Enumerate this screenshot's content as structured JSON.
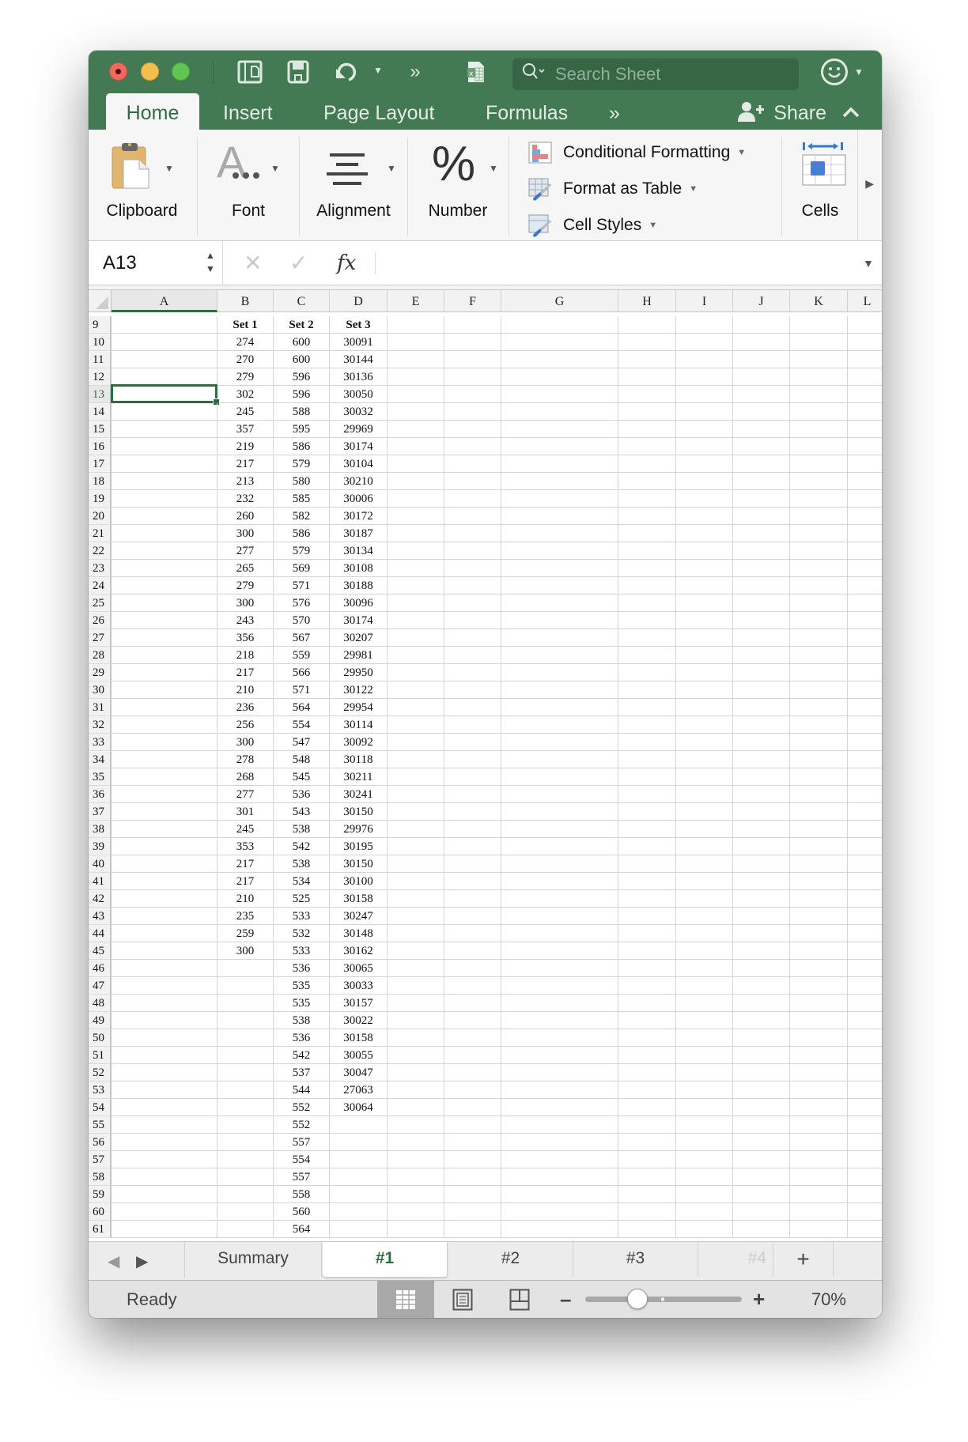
{
  "window": {
    "toolbar": {
      "search_placeholder": "Search Sheet",
      "icons": [
        "sidebar-icon",
        "save-icon",
        "undo-icon",
        "more-icon",
        "excel-doc-icon",
        "smiley-feedback-icon"
      ]
    },
    "ribbon_tabs": [
      {
        "label": "Home",
        "active": true
      },
      {
        "label": "Insert",
        "active": false
      },
      {
        "label": "Page Layout",
        "active": false
      },
      {
        "label": "Formulas",
        "active": false
      }
    ],
    "more_tabs_label": "»",
    "share_label": "Share",
    "ribbon_groups": {
      "clipboard": "Clipboard",
      "font": "Font",
      "alignment": "Alignment",
      "number": "Number",
      "number_glyph": "%",
      "font_glyph": "A",
      "cells": "Cells",
      "styles": [
        {
          "label": "Conditional Formatting"
        },
        {
          "label": "Format as Table"
        },
        {
          "label": "Cell Styles"
        }
      ]
    }
  },
  "formula_bar": {
    "name_box": "A13",
    "cancel_glyph": "✕",
    "enter_glyph": "✓",
    "fx_label": "fx",
    "formula_value": ""
  },
  "grid": {
    "columns": [
      "A",
      "B",
      "C",
      "D",
      "E",
      "F",
      "G",
      "H",
      "I",
      "J",
      "K",
      "L"
    ],
    "selected_column": "A",
    "selected_row": 13,
    "rows": [
      {
        "n": 9,
        "B": "Set 1",
        "C": "Set 2",
        "D": "Set 3",
        "header": true
      },
      {
        "n": 10,
        "B": "274",
        "C": "600",
        "D": "30091"
      },
      {
        "n": 11,
        "B": "270",
        "C": "600",
        "D": "30144"
      },
      {
        "n": 12,
        "B": "279",
        "C": "596",
        "D": "30136"
      },
      {
        "n": 13,
        "B": "302",
        "C": "596",
        "D": "30050"
      },
      {
        "n": 14,
        "B": "245",
        "C": "588",
        "D": "30032"
      },
      {
        "n": 15,
        "B": "357",
        "C": "595",
        "D": "29969"
      },
      {
        "n": 16,
        "B": "219",
        "C": "586",
        "D": "30174"
      },
      {
        "n": 17,
        "B": "217",
        "C": "579",
        "D": "30104"
      },
      {
        "n": 18,
        "B": "213",
        "C": "580",
        "D": "30210"
      },
      {
        "n": 19,
        "B": "232",
        "C": "585",
        "D": "30006"
      },
      {
        "n": 20,
        "B": "260",
        "C": "582",
        "D": "30172"
      },
      {
        "n": 21,
        "B": "300",
        "C": "586",
        "D": "30187"
      },
      {
        "n": 22,
        "B": "277",
        "C": "579",
        "D": "30134"
      },
      {
        "n": 23,
        "B": "265",
        "C": "569",
        "D": "30108"
      },
      {
        "n": 24,
        "B": "279",
        "C": "571",
        "D": "30188"
      },
      {
        "n": 25,
        "B": "300",
        "C": "576",
        "D": "30096"
      },
      {
        "n": 26,
        "B": "243",
        "C": "570",
        "D": "30174"
      },
      {
        "n": 27,
        "B": "356",
        "C": "567",
        "D": "30207"
      },
      {
        "n": 28,
        "B": "218",
        "C": "559",
        "D": "29981"
      },
      {
        "n": 29,
        "B": "217",
        "C": "566",
        "D": "29950"
      },
      {
        "n": 30,
        "B": "210",
        "C": "571",
        "D": "30122"
      },
      {
        "n": 31,
        "B": "236",
        "C": "564",
        "D": "29954"
      },
      {
        "n": 32,
        "B": "256",
        "C": "554",
        "D": "30114"
      },
      {
        "n": 33,
        "B": "300",
        "C": "547",
        "D": "30092"
      },
      {
        "n": 34,
        "B": "278",
        "C": "548",
        "D": "30118"
      },
      {
        "n": 35,
        "B": "268",
        "C": "545",
        "D": "30211"
      },
      {
        "n": 36,
        "B": "277",
        "C": "536",
        "D": "30241"
      },
      {
        "n": 37,
        "B": "301",
        "C": "543",
        "D": "30150"
      },
      {
        "n": 38,
        "B": "245",
        "C": "538",
        "D": "29976"
      },
      {
        "n": 39,
        "B": "353",
        "C": "542",
        "D": "30195"
      },
      {
        "n": 40,
        "B": "217",
        "C": "538",
        "D": "30150"
      },
      {
        "n": 41,
        "B": "217",
        "C": "534",
        "D": "30100"
      },
      {
        "n": 42,
        "B": "210",
        "C": "525",
        "D": "30158"
      },
      {
        "n": 43,
        "B": "235",
        "C": "533",
        "D": "30247"
      },
      {
        "n": 44,
        "B": "259",
        "C": "532",
        "D": "30148"
      },
      {
        "n": 45,
        "B": "300",
        "C": "533",
        "D": "30162"
      },
      {
        "n": 46,
        "B": "",
        "C": "536",
        "D": "30065"
      },
      {
        "n": 47,
        "B": "",
        "C": "535",
        "D": "30033"
      },
      {
        "n": 48,
        "B": "",
        "C": "535",
        "D": "30157"
      },
      {
        "n": 49,
        "B": "",
        "C": "538",
        "D": "30022"
      },
      {
        "n": 50,
        "B": "",
        "C": "536",
        "D": "30158"
      },
      {
        "n": 51,
        "B": "",
        "C": "542",
        "D": "30055"
      },
      {
        "n": 52,
        "B": "",
        "C": "537",
        "D": "30047"
      },
      {
        "n": 53,
        "B": "",
        "C": "544",
        "D": "27063"
      },
      {
        "n": 54,
        "B": "",
        "C": "552",
        "D": "30064"
      },
      {
        "n": 55,
        "B": "",
        "C": "552",
        "D": ""
      },
      {
        "n": 56,
        "B": "",
        "C": "557",
        "D": ""
      },
      {
        "n": 57,
        "B": "",
        "C": "554",
        "D": ""
      },
      {
        "n": 58,
        "B": "",
        "C": "557",
        "D": ""
      },
      {
        "n": 59,
        "B": "",
        "C": "558",
        "D": ""
      },
      {
        "n": 60,
        "B": "",
        "C": "560",
        "D": ""
      },
      {
        "n": 61,
        "B": "",
        "C": "564",
        "D": ""
      }
    ]
  },
  "sheet_tabs": [
    {
      "label": "Summary",
      "active": false
    },
    {
      "label": "#1",
      "active": true
    },
    {
      "label": "#2",
      "active": false
    },
    {
      "label": "#3",
      "active": false
    },
    {
      "label": "#4",
      "active": false,
      "faded": true
    }
  ],
  "add_sheet_label": "+",
  "status": {
    "text": "Ready",
    "zoom_level": "70%",
    "zoom_percent": 70,
    "view_mode": "normal"
  },
  "colors": {
    "brand_green": "#447a53",
    "selection_green": "#2f6c40"
  }
}
